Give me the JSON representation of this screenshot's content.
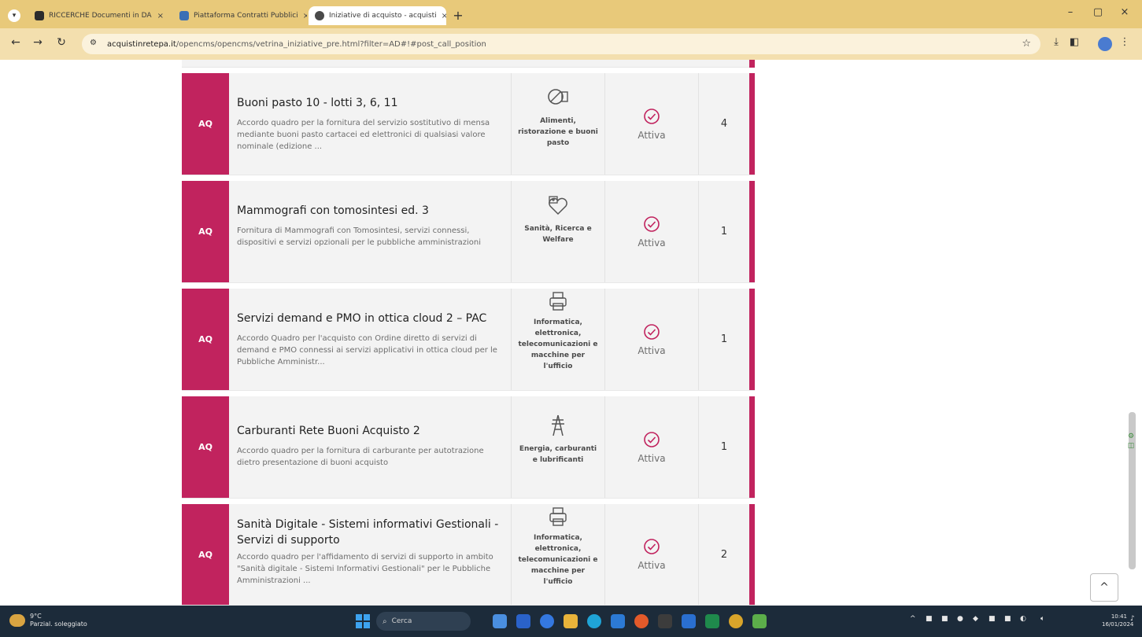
{
  "browser": {
    "tabs": [
      {
        "label": "RICCERCHE Documenti in DA",
        "active": false,
        "favicon_color": "#2c2c2c"
      },
      {
        "label": "Piattaforma Contratti Pubblici",
        "active": false,
        "favicon_color": "#3a6fb5"
      },
      {
        "label": "Iniziative di acquisto - acquisti",
        "active": true,
        "favicon_color": "#4a4a4a"
      }
    ],
    "tab_close": "×",
    "new_tab": "+",
    "url_host": "acquistinretepa.it",
    "url_path": "/opencms/opencms/vetrina_iniziative_pre.html?filter=AD#!#post_call_position",
    "window_controls": {
      "minimize": "–",
      "maximize": "▢",
      "close": "×"
    }
  },
  "rows": [
    {
      "tag": "AQ",
      "title": "Buoni pasto 10 - lotti 3, 6, 11",
      "description": "Accordo quadro per la fornitura del servizio sostitutivo di mensa mediante buoni pasto cartacei ed elettronici di qualsiasi valore nominale (edizione ...",
      "category": "Alimenti, ristorazione e buoni pasto",
      "category_icon": "food-icon",
      "status": "Attiva",
      "count": "4"
    },
    {
      "tag": "AQ",
      "title": "Mammografi con tomosintesi ed. 3",
      "description": "Fornitura di Mammografi con Tomosintesi, servizi connessi, dispositivi e servizi opzionali per le pubbliche amministrazioni",
      "category": "Sanità, Ricerca e Welfare",
      "category_icon": "health-icon",
      "status": "Attiva",
      "count": "1"
    },
    {
      "tag": "AQ",
      "title": "Servizi demand e PMO in ottica cloud 2 – PAC",
      "description": "Accordo Quadro per l'acquisto con Ordine diretto di servizi di demand e PMO connessi ai servizi applicativi in ottica cloud per le Pubbliche Amministr...",
      "category": "Informatica, elettronica, telecomunicazioni e macchine per l'ufficio",
      "category_icon": "printer-icon",
      "status": "Attiva",
      "count": "1"
    },
    {
      "tag": "AQ",
      "title": "Carburanti Rete Buoni Acquisto 2",
      "description": "Accordo quadro per la fornitura di carburante per autotrazione dietro presentazione di buoni acquisto",
      "category": "Energia, carburanti e lubrificanti",
      "category_icon": "pylon-icon",
      "status": "Attiva",
      "count": "1"
    },
    {
      "tag": "AQ",
      "title": "Sanità Digitale - Sistemi informativi Gestionali - Servizi di supporto",
      "description": "Accordo quadro per l'affidamento di servizi di supporto in ambito \"Sanità digitale - Sistemi Informativi Gestionali\" per le Pubbliche Amministrazioni ...",
      "category": "Informatica, elettronica, telecomunicazioni e macchine per l'ufficio",
      "category_icon": "printer-icon",
      "status": "Attiva",
      "count": "2"
    }
  ],
  "back_to_top": "^",
  "taskbar": {
    "weather_temp": "9°C",
    "weather_desc": "Parzial. soleggiato",
    "search_placeholder": "Cerca",
    "clock_time": "10:41",
    "clock_date": "16/01/2024"
  },
  "colors": {
    "accent": "#c1235e",
    "row_bg": "#f3f3f3",
    "tab_strip": "#e8c97a",
    "taskbar": "#1c2b3a"
  }
}
